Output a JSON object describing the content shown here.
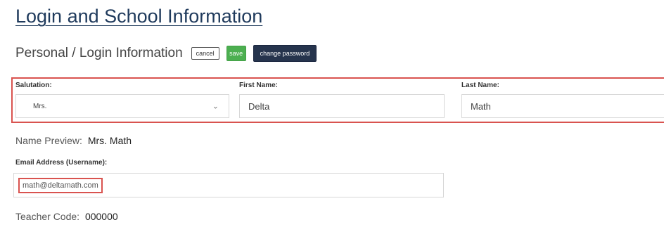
{
  "page": {
    "title": "Login and School Information"
  },
  "personal_section": {
    "heading": "Personal / Login Information",
    "cancel_label": "cancel",
    "save_label": "save",
    "change_password_label": "change password"
  },
  "name_fields": {
    "salutation": {
      "label": "Salutation:",
      "value": "Mrs."
    },
    "first_name": {
      "label": "First Name:",
      "value": "Delta"
    },
    "last_name": {
      "label": "Last Name:",
      "value": "Math"
    }
  },
  "name_preview": {
    "label": "Name Preview:",
    "value": "Mrs. Math"
  },
  "email": {
    "label": "Email Address (Username):",
    "value": "math@deltamath.com"
  },
  "teacher_code": {
    "label": "Teacher Code:",
    "value": "000000"
  },
  "colors": {
    "title": "#1f3a5c",
    "save_button": "#4caf50",
    "change_password_button": "#26344d",
    "highlight": "#d9534f"
  }
}
